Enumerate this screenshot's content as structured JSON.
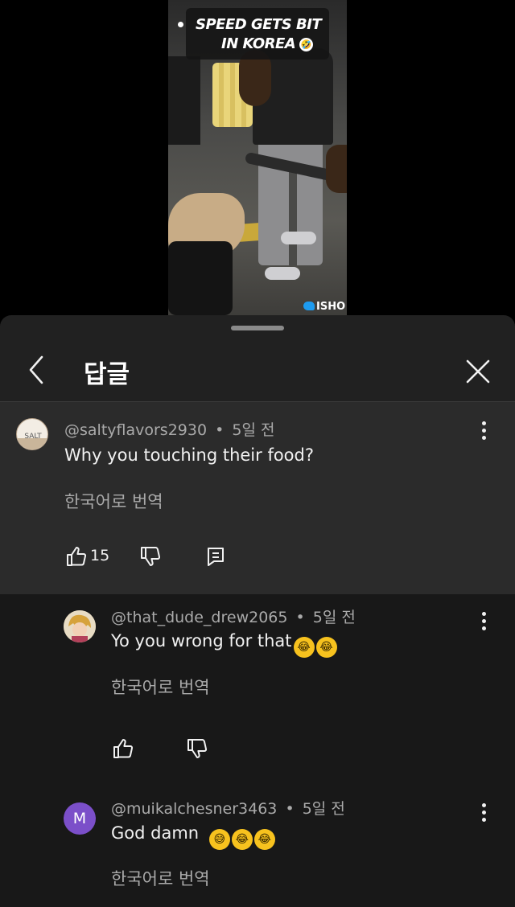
{
  "video": {
    "caption_line1": "SPEED GETS BIT",
    "caption_line2": "IN KOREA",
    "caption_emoji": "🤣",
    "watermark": "ISHO"
  },
  "sheet": {
    "title": "답글",
    "back_icon": "chevron-left-icon",
    "close_icon": "close-icon"
  },
  "comments": [
    {
      "author": "@saltyflavors2930",
      "time": "5일 전",
      "text": "Why you touching their food?",
      "translate": "한국어로 번역",
      "likes": "15",
      "avatar_text": "SALT"
    },
    {
      "author": "@that_dude_drew2065",
      "time": "5일 전",
      "text": "Yo you wrong for that",
      "emojis": [
        "😂",
        "😂"
      ],
      "translate": "한국어로 번역"
    },
    {
      "author": "@muikalchesner3463",
      "time": "5일 전",
      "text": "God damn",
      "emojis": [
        "😅",
        "😂",
        "😂"
      ],
      "translate": "한국어로 번역",
      "avatar_letter": "M",
      "avatar_color": "#7b4fc9"
    }
  ],
  "separator": "•"
}
